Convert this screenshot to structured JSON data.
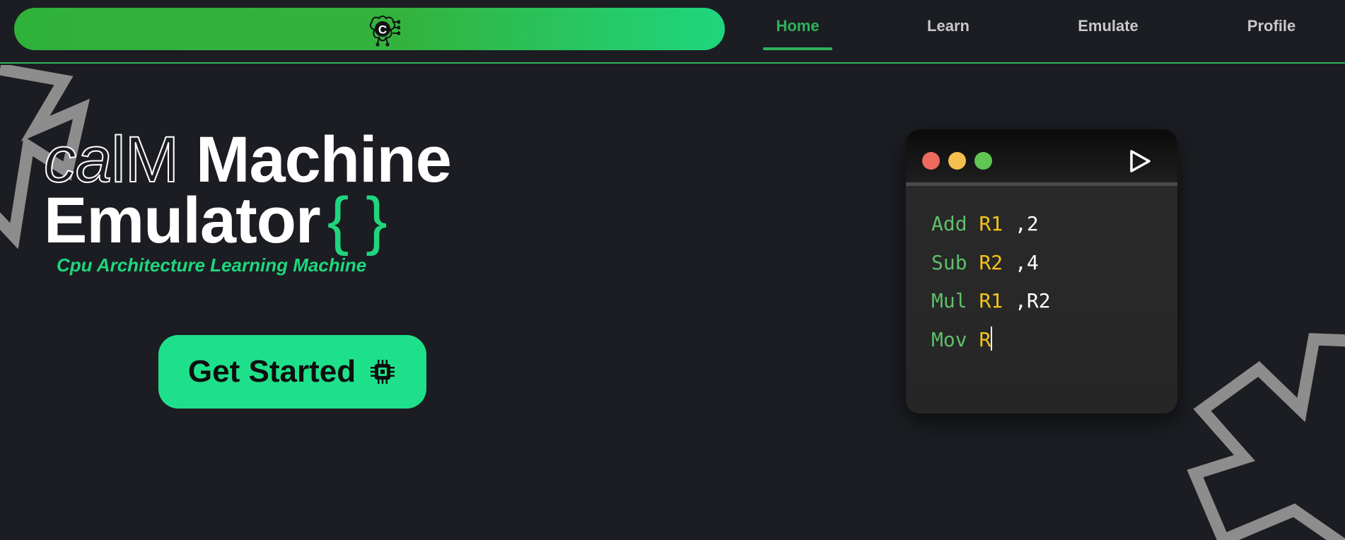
{
  "nav": {
    "brand_letter": "C",
    "links": [
      {
        "label": "Home",
        "active": true
      },
      {
        "label": "Learn",
        "active": false
      },
      {
        "label": "Emulate",
        "active": false
      },
      {
        "label": "Profile",
        "active": false
      }
    ]
  },
  "hero": {
    "title_ca": "ca",
    "title_lm": "lM",
    "title_machine": "Machine",
    "title_emulator": "Emulator",
    "title_braces": "{ }",
    "subtitle": "Cpu Architecture Learning Machine",
    "cta_label": "Get Started"
  },
  "code_window": {
    "lines": [
      {
        "op": "Add",
        "reg": "R1",
        "args": ",2"
      },
      {
        "op": "Sub",
        "reg": "R2",
        "args": ",4"
      },
      {
        "op": "Mul",
        "reg": "R1",
        "args": ",R2"
      },
      {
        "op": "Mov",
        "reg": "R",
        "args": ""
      }
    ]
  },
  "icons": {
    "brand": "brain-chip-icon",
    "cta": "cpu-chip-icon",
    "run": "play-icon"
  },
  "colors": {
    "background": "#1b1d22",
    "accent_green": "#2fb25a",
    "mint": "#1fe08a",
    "code_keyword": "#5fbf6a",
    "code_register": "#f5c518"
  }
}
